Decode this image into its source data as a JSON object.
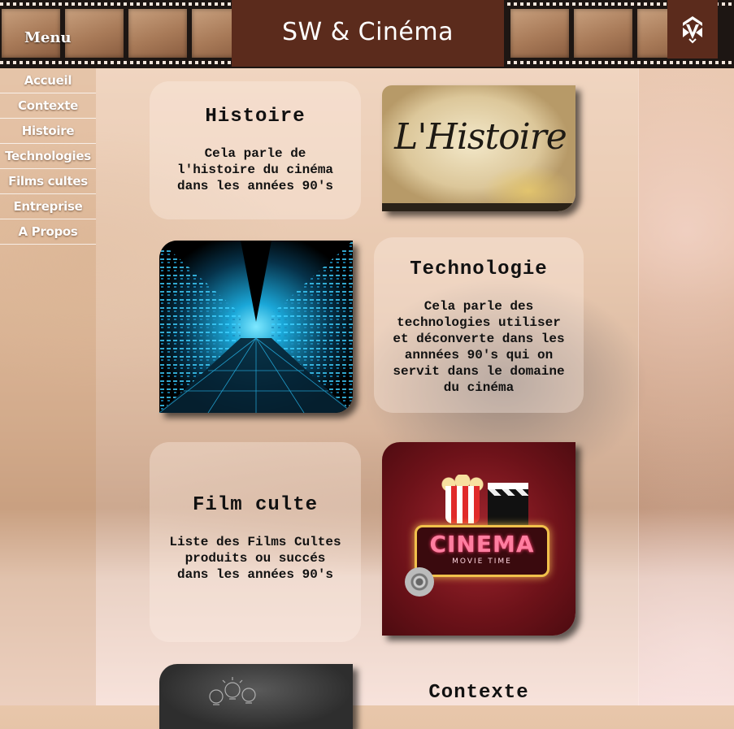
{
  "header": {
    "menu_label": "Menu",
    "site_title": "SW & Cinéma",
    "logo_icon": "shield-logo-icon"
  },
  "nav": {
    "items": [
      {
        "label": "Accueil"
      },
      {
        "label": "Contexte"
      },
      {
        "label": "Histoire"
      },
      {
        "label": "Technologies"
      },
      {
        "label": "Films cultes"
      },
      {
        "label": "Entreprise"
      },
      {
        "label": "A Propos"
      }
    ]
  },
  "cards": [
    {
      "title": "Histoire",
      "description": "Cela parle de\nl'histoire du cinéma\ndans les années 90's",
      "image_text": "L'Histoire"
    },
    {
      "title": "Technologie",
      "description": "Cela parle des\ntechnologies utiliser\net déconverte dans les\nannnées 90's qui on\nservit dans le domaine\ndu cinéma"
    },
    {
      "title": "Film culte",
      "description": "Liste des Films Cultes\nproduits ou succés\ndans les années 90's",
      "image_text": "CINEMA",
      "image_subtext": "MOVIE TIME"
    },
    {
      "title": "Contexte"
    }
  ],
  "colors": {
    "title_bar": "#5b2b1c",
    "film_strip": "#1d1613",
    "nav_text": "#ffffff"
  }
}
